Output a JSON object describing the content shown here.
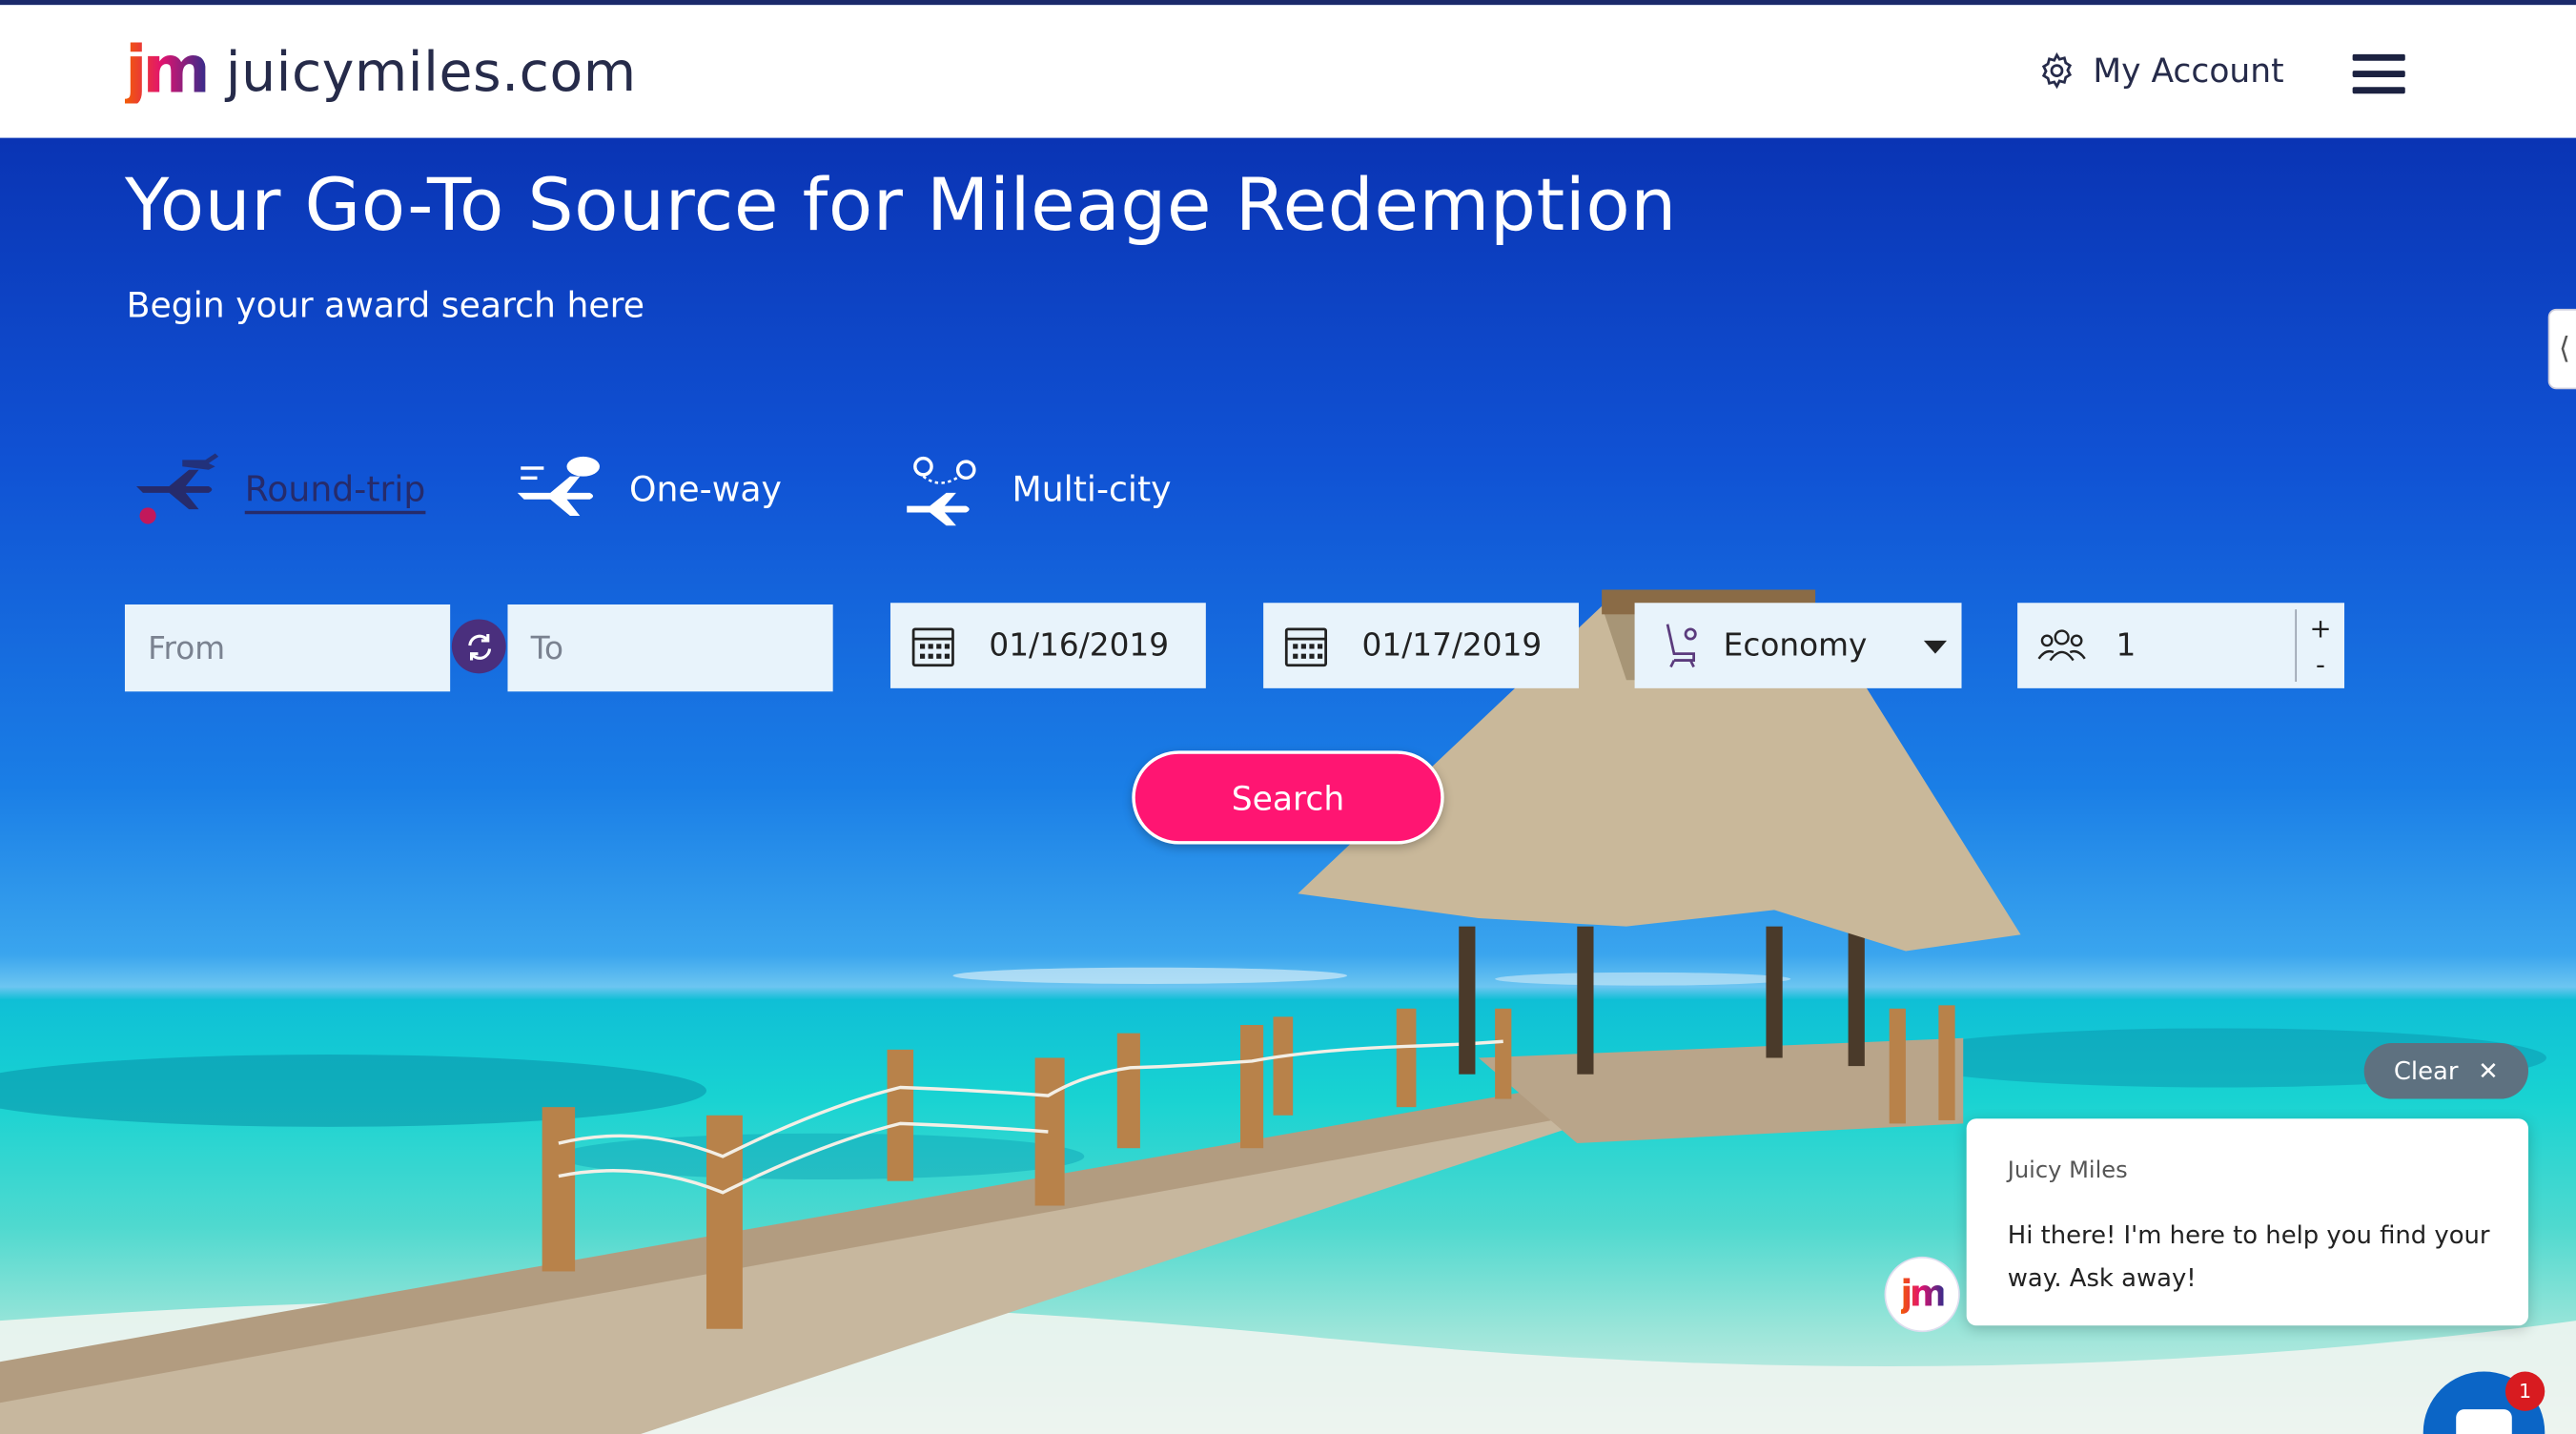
{
  "brand": {
    "mark": "jm",
    "name": "juicymiles.com"
  },
  "header": {
    "account_label": "My Account"
  },
  "hero": {
    "title": "Your Go-To Source for Mileage Redemption",
    "subtitle": "Begin your award search here"
  },
  "trip_types": [
    {
      "label": "Round-trip",
      "active": true
    },
    {
      "label": "One-way",
      "active": false
    },
    {
      "label": "Multi-city",
      "active": false
    }
  ],
  "form": {
    "from_placeholder": "From",
    "to_placeholder": "To",
    "depart_date": "01/16/2019",
    "return_date": "01/17/2019",
    "cabin": "Economy",
    "passengers": "1",
    "plus": "+",
    "minus": "-",
    "search_label": "Search"
  },
  "side_tab": {
    "glyph": "⟨"
  },
  "chat": {
    "clear_label": "Clear",
    "sender": "Juicy Miles",
    "message": "Hi there! I'm here to help you find your way. Ask away!",
    "avatar_text": "jm",
    "unread_count": "1"
  },
  "colors": {
    "accent": "#ff1572",
    "navy": "#262b6b",
    "swap": "#4a2f7d",
    "chat_blue": "#0b65c6"
  }
}
